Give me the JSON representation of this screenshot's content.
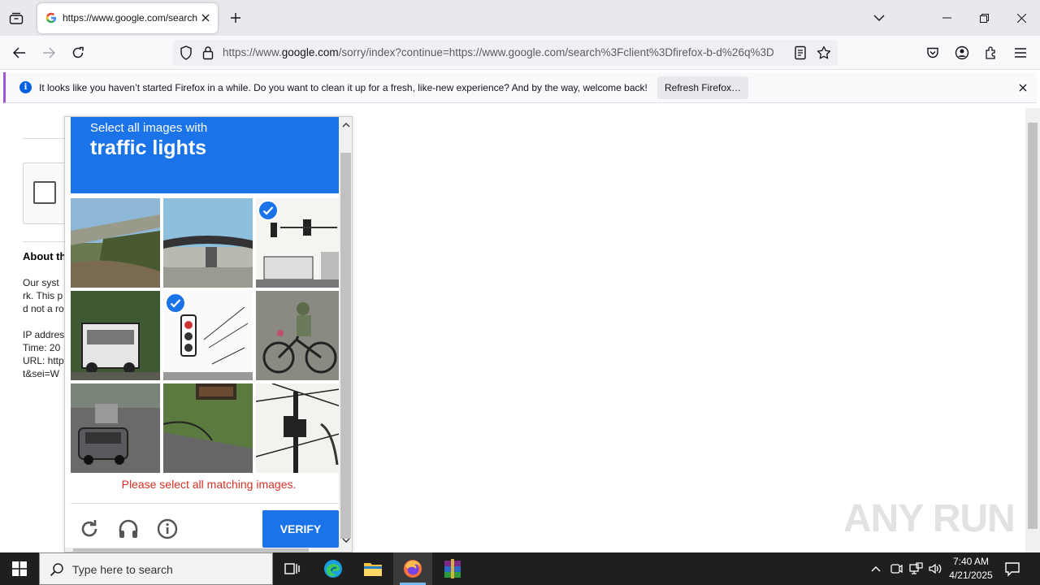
{
  "browser": {
    "tab": {
      "title": "https://www.google.com/search"
    },
    "url": {
      "prefix": "https://www.",
      "domain": "google.com",
      "rest": "/sorry/index?continue=https://www.google.com/search%3Fclient%3Dfirefox-b-d%26q%3D"
    },
    "notification": {
      "text": "It looks like you haven’t started Firefox in a while. Do you want to clean it up for a fresh, like-new experience? And by the way, welcome back!",
      "button": "Refresh Firefox…"
    }
  },
  "page": {
    "heading": "About th",
    "lines": [
      "Our syst",
      "rk. This p",
      "d not a ro",
      "",
      "IP addres",
      "Time: 20",
      "URL: http",
      "t&sei=W"
    ]
  },
  "captcha": {
    "instruction_small": "Select all images with",
    "instruction_big": "traffic lights",
    "tiles_selected": [
      false,
      false,
      true,
      false,
      true,
      false,
      false,
      false,
      false
    ],
    "error": "Please select all matching images.",
    "verify": "VERIFY",
    "accent_color": "#1a73e8",
    "error_color": "#d93025"
  },
  "watermark": "ANY RUN",
  "taskbar": {
    "search_placeholder": "Type here to search",
    "time": "7:40 AM",
    "date": "4/21/2025"
  }
}
